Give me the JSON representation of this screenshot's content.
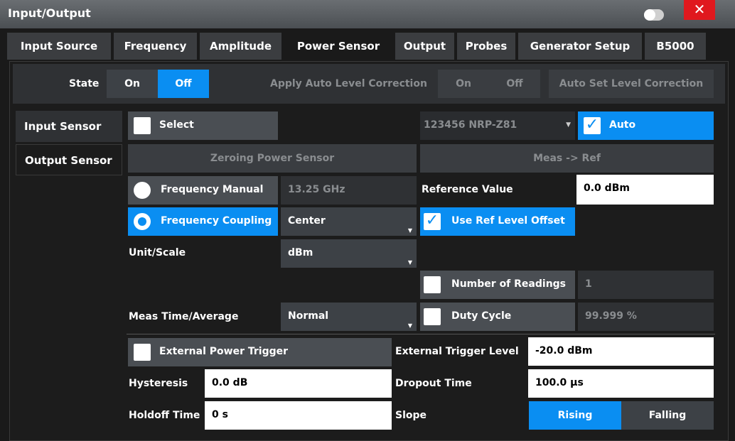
{
  "window": {
    "title": "Input/Output",
    "close_glyph": "✕"
  },
  "tabs": [
    "Input Source",
    "Frequency",
    "Amplitude",
    "Power Sensor",
    "Output",
    "Probes",
    "Generator Setup",
    "B5000"
  ],
  "state": {
    "label": "State",
    "on": "On",
    "off": "Off"
  },
  "auto_level": {
    "label": "Apply Auto Level Correction",
    "on": "On",
    "off": "Off",
    "set_button": "Auto Set Level Correction"
  },
  "sensors": {
    "input": "Input Sensor",
    "output": "Output Sensor"
  },
  "select": {
    "label": "Select",
    "device": "123456 NRP-Z81",
    "auto": "Auto"
  },
  "zeroing": "Zeroing Power Sensor",
  "meas_ref": "Meas -> Ref",
  "freq_manual": {
    "label": "Frequency Manual",
    "value": "13.25 GHz"
  },
  "reference": {
    "label": "Reference Value",
    "value": "0.0 dBm"
  },
  "freq_coupling": {
    "label": "Frequency Coupling",
    "value": "Center"
  },
  "ref_offset": {
    "label": "Use Ref Level Offset"
  },
  "unit_scale": {
    "label": "Unit/Scale",
    "value": "dBm"
  },
  "readings": {
    "label": "Number of Readings",
    "value": "1"
  },
  "meas_time": {
    "label": "Meas Time/Average",
    "value": "Normal"
  },
  "duty_cycle": {
    "label": "Duty Cycle",
    "value": "99.999 %"
  },
  "ext_trigger": {
    "label": "External Power Trigger",
    "level_label": "External Trigger Level",
    "level_value": "-20.0 dBm"
  },
  "hysteresis": {
    "label": "Hysteresis",
    "value": "0.0 dB"
  },
  "dropout": {
    "label": "Dropout Time",
    "value": "100.0 µs"
  },
  "holdoff": {
    "label": "Holdoff Time",
    "value": "0 s"
  },
  "slope": {
    "label": "Slope",
    "rising": "Rising",
    "falling": "Falling"
  },
  "colors": {
    "accent": "#0a8ef2",
    "close": "#e0181e"
  }
}
